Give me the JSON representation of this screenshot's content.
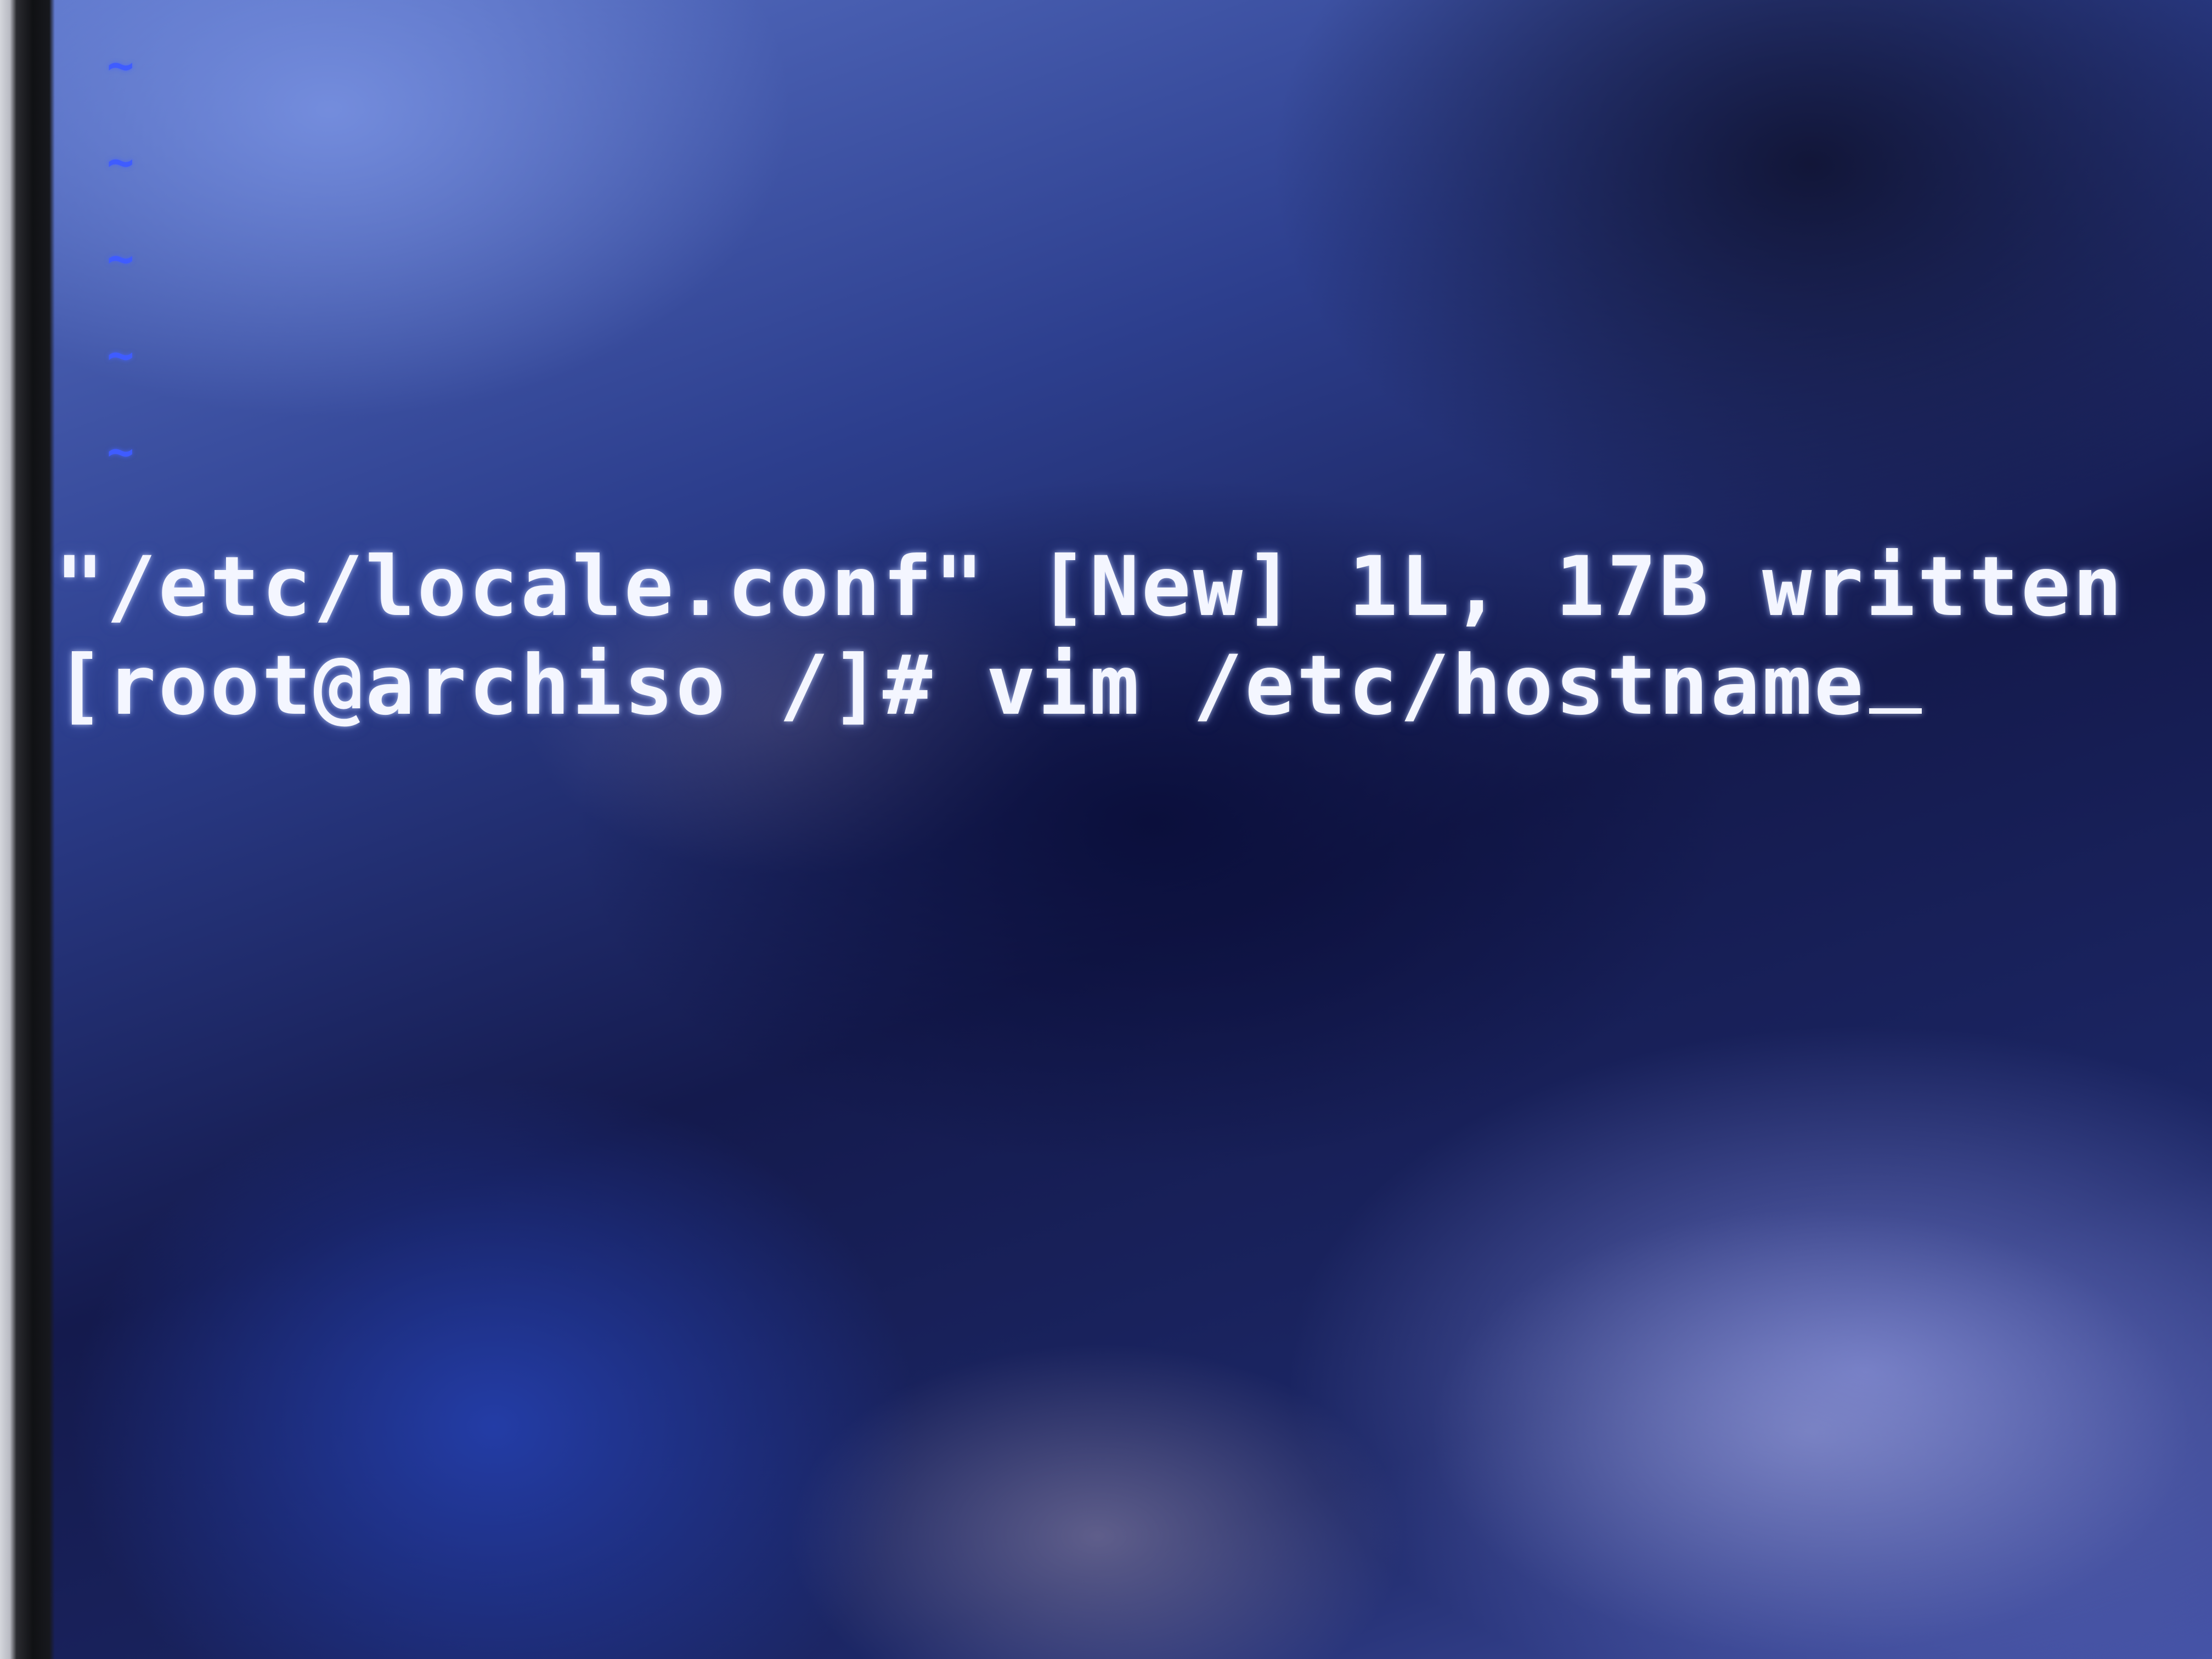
{
  "vim_empty_line_markers": [
    "~",
    "~",
    "~",
    "~",
    "~"
  ],
  "terminal": {
    "status_message": "\"/etc/locale.conf\" [New] 1L, 17B written",
    "prompt": "[root@archiso /]#",
    "command": "vim /etc/hostname"
  },
  "colors": {
    "tilde_marker": "#3f5cff",
    "terminal_text": "#f4f6ff"
  },
  "icons": {
    "cursor": "text-cursor-underscore"
  }
}
